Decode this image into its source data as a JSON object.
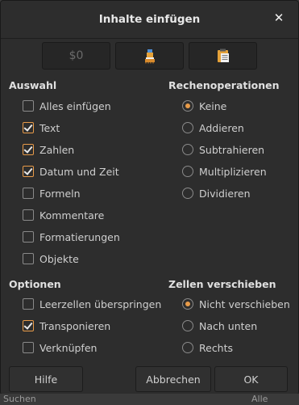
{
  "dialog": {
    "title": "Inhalte einfügen",
    "close_glyph": "✕"
  },
  "modes": [
    {
      "label": "$0",
      "icon": "values-only-icon"
    },
    {
      "label": "",
      "icon": "paste-formats-icon"
    },
    {
      "label": "",
      "icon": "paste-all-icon"
    }
  ],
  "selection": {
    "heading": "Auswahl",
    "items": [
      {
        "label": "Alles einfügen",
        "checked": false
      },
      {
        "label": "Text",
        "checked": true
      },
      {
        "label": "Zahlen",
        "checked": true
      },
      {
        "label": "Datum und Zeit",
        "checked": true
      },
      {
        "label": "Formeln",
        "checked": false
      },
      {
        "label": "Kommentare",
        "checked": false
      },
      {
        "label": "Formatierungen",
        "checked": false
      },
      {
        "label": "Objekte",
        "checked": false
      }
    ]
  },
  "operations": {
    "heading": "Rechenoperationen",
    "items": [
      {
        "label": "Keine",
        "checked": true
      },
      {
        "label": "Addieren",
        "checked": false
      },
      {
        "label": "Subtrahieren",
        "checked": false
      },
      {
        "label": "Multiplizieren",
        "checked": false
      },
      {
        "label": "Dividieren",
        "checked": false
      }
    ]
  },
  "options": {
    "heading": "Optionen",
    "items": [
      {
        "label": "Leerzellen überspringen",
        "checked": false
      },
      {
        "label": "Transponieren",
        "checked": true
      },
      {
        "label": "Verknüpfen",
        "checked": false
      }
    ]
  },
  "shift": {
    "heading": "Zellen verschieben",
    "items": [
      {
        "label": "Nicht verschieben",
        "checked": true
      },
      {
        "label": "Nach unten",
        "checked": false
      },
      {
        "label": "Rechts",
        "checked": false
      }
    ]
  },
  "buttons": {
    "help": "Hilfe",
    "cancel": "Abbrechen",
    "ok": "OK"
  },
  "background": {
    "left_text": "Suchen",
    "right_text": "Alle suchen"
  },
  "colors": {
    "accent": "#e89b49",
    "dialog_bg": "#2d2d2d"
  }
}
